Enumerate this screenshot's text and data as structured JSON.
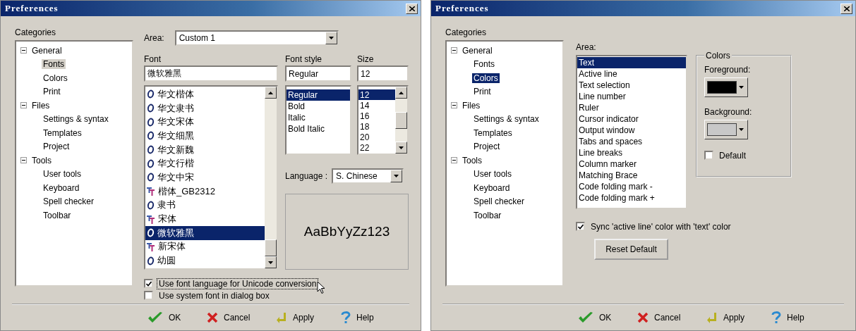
{
  "windows": [
    {
      "title": "Preferences",
      "categories_label": "Categories",
      "tree": {
        "focused": false,
        "items": [
          {
            "label": "General",
            "expanded": true,
            "selected": false,
            "children": [
              {
                "label": "Fonts",
                "selected": true
              },
              {
                "label": "Colors",
                "selected": false
              },
              {
                "label": "Print",
                "selected": false
              }
            ]
          },
          {
            "label": "Files",
            "expanded": true,
            "selected": false,
            "children": [
              {
                "label": "Settings & syntax",
                "selected": false
              },
              {
                "label": "Templates",
                "selected": false
              },
              {
                "label": "Project",
                "selected": false
              }
            ]
          },
          {
            "label": "Tools",
            "expanded": true,
            "selected": false,
            "children": [
              {
                "label": "User tools",
                "selected": false
              },
              {
                "label": "Keyboard",
                "selected": false
              },
              {
                "label": "Spell checker",
                "selected": false
              },
              {
                "label": "Toolbar",
                "selected": false
              }
            ]
          }
        ]
      },
      "panel": {
        "kind": "fonts",
        "area": {
          "label": "Area:",
          "value": "Custom 1"
        },
        "font": {
          "label": "Font",
          "value": "微软雅黑",
          "items": [
            {
              "name": "华文楷体",
              "kind": "opentype",
              "selected": false
            },
            {
              "name": "华文隶书",
              "kind": "opentype",
              "selected": false
            },
            {
              "name": "华文宋体",
              "kind": "opentype",
              "selected": false
            },
            {
              "name": "华文细黑",
              "kind": "opentype",
              "selected": false
            },
            {
              "name": "华文新魏",
              "kind": "opentype",
              "selected": false
            },
            {
              "name": "华文行楷",
              "kind": "opentype",
              "selected": false
            },
            {
              "name": "华文中宋",
              "kind": "opentype",
              "selected": false
            },
            {
              "name": "楷体_GB2312",
              "kind": "truetype",
              "selected": false
            },
            {
              "name": "隶书",
              "kind": "opentype",
              "selected": false
            },
            {
              "name": "宋体",
              "kind": "truetype",
              "selected": false
            },
            {
              "name": "微软雅黑",
              "kind": "opentype",
              "selected": true
            },
            {
              "name": "新宋体",
              "kind": "truetype",
              "selected": false
            },
            {
              "name": "幼圆",
              "kind": "opentype",
              "selected": false
            }
          ]
        },
        "style": {
          "label": "Font style",
          "value": "Regular",
          "items": [
            {
              "name": "Regular",
              "selected": true
            },
            {
              "name": "Bold",
              "selected": false
            },
            {
              "name": "Italic",
              "selected": false
            },
            {
              "name": "Bold Italic",
              "selected": false
            }
          ]
        },
        "size": {
          "label": "Size",
          "value": "12",
          "items": [
            {
              "name": "12",
              "selected": true
            },
            {
              "name": "14",
              "selected": false
            },
            {
              "name": "16",
              "selected": false
            },
            {
              "name": "18",
              "selected": false
            },
            {
              "name": "20",
              "selected": false
            },
            {
              "name": "22",
              "selected": false
            }
          ]
        },
        "language": {
          "label": "Language :",
          "value": "S. Chinese"
        },
        "preview": "AaBbYyZz123",
        "checkboxes": [
          {
            "label": "Use font language for Unicode conversion",
            "checked": true,
            "focused": true
          },
          {
            "label": "Use system font in dialog box",
            "checked": false,
            "focused": false
          }
        ]
      },
      "buttons": [
        {
          "label": "OK",
          "kind": "ok"
        },
        {
          "label": "Cancel",
          "kind": "cancel"
        },
        {
          "label": "Apply",
          "kind": "apply"
        },
        {
          "label": "Help",
          "kind": "help"
        }
      ]
    },
    {
      "title": "Preferences",
      "categories_label": "Categories",
      "tree": {
        "focused": true,
        "items": [
          {
            "label": "General",
            "expanded": true,
            "selected": false,
            "children": [
              {
                "label": "Fonts",
                "selected": false
              },
              {
                "label": "Colors",
                "selected": true
              },
              {
                "label": "Print",
                "selected": false
              }
            ]
          },
          {
            "label": "Files",
            "expanded": true,
            "selected": false,
            "children": [
              {
                "label": "Settings & syntax",
                "selected": false
              },
              {
                "label": "Templates",
                "selected": false
              },
              {
                "label": "Project",
                "selected": false
              }
            ]
          },
          {
            "label": "Tools",
            "expanded": true,
            "selected": false,
            "children": [
              {
                "label": "User tools",
                "selected": false
              },
              {
                "label": "Keyboard",
                "selected": false
              },
              {
                "label": "Spell checker",
                "selected": false
              },
              {
                "label": "Toolbar",
                "selected": false
              }
            ]
          }
        ]
      },
      "panel": {
        "kind": "colors",
        "area_label": "Area:",
        "areas": [
          {
            "name": "Text",
            "selected": true
          },
          {
            "name": "Active line",
            "selected": false
          },
          {
            "name": "Text selection",
            "selected": false
          },
          {
            "name": "Line number",
            "selected": false
          },
          {
            "name": "Ruler",
            "selected": false
          },
          {
            "name": "Cursor indicator",
            "selected": false
          },
          {
            "name": "Output window",
            "selected": false
          },
          {
            "name": "Tabs and spaces",
            "selected": false
          },
          {
            "name": "Line breaks",
            "selected": false
          },
          {
            "name": "Column marker",
            "selected": false
          },
          {
            "name": "Matching Brace",
            "selected": false
          },
          {
            "name": "Code folding mark -",
            "selected": false
          },
          {
            "name": "Code folding mark +",
            "selected": false
          }
        ],
        "colors_title": "Colors",
        "swatches": [
          {
            "label": "Foreground:",
            "color": "#000000"
          },
          {
            "label": "Background:",
            "color": "#c8c8c8"
          }
        ],
        "default": {
          "label": "Default",
          "checked": false
        },
        "sync": {
          "label": "Sync 'active line' color with 'text' color",
          "checked": true
        },
        "reset": "Reset Default"
      },
      "buttons": [
        {
          "label": "OK",
          "kind": "ok"
        },
        {
          "label": "Cancel",
          "kind": "cancel"
        },
        {
          "label": "Apply",
          "kind": "apply"
        },
        {
          "label": "Help",
          "kind": "help"
        }
      ]
    }
  ]
}
